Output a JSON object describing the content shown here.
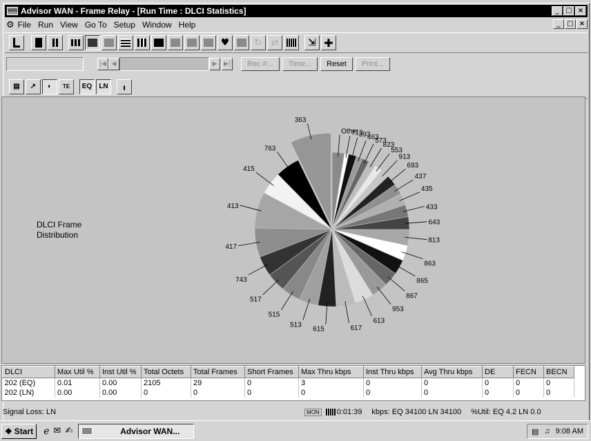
{
  "window": {
    "title": "Advisor WAN - Frame Relay - [Run Time : DLCI Statistics]",
    "min": "_",
    "restore": "&#9633;",
    "close": "x"
  },
  "menu": [
    "File",
    "Run",
    "View",
    "Go To",
    "Setup",
    "Window",
    "Help"
  ],
  "controls": {
    "rec": "Rec #...",
    "time": "Time...",
    "reset": "Reset",
    "print": "Print...",
    "eq": "EQ",
    "ln": "LN"
  },
  "chart_label": "DLCI Frame\nDistribution",
  "chart_data": {
    "type": "pie",
    "title": "DLCI Frame Distribution",
    "slices": [
      {
        "label": "Other",
        "value": 2.3,
        "color": "#8a8a8a"
      },
      {
        "label": "713",
        "value": 0.8,
        "color": "#ffffff"
      },
      {
        "label": "393",
        "value": 1.5,
        "color": "#111111"
      },
      {
        "label": "463",
        "value": 1.2,
        "color": "#9a9a9a"
      },
      {
        "label": "573",
        "value": 1.3,
        "color": "#666666"
      },
      {
        "label": "823",
        "value": 1.4,
        "color": "#bdbdbd"
      },
      {
        "label": "553",
        "value": 1.5,
        "color": "#e8e8e8"
      },
      {
        "label": "913",
        "value": 1.6,
        "color": "#c6c6c6"
      },
      {
        "label": "693",
        "value": 2.0,
        "color": "#222222"
      },
      {
        "label": "437",
        "value": 2.0,
        "color": "#8f8f8f"
      },
      {
        "label": "435",
        "value": 2.2,
        "color": "#b0b0b0"
      },
      {
        "label": "433",
        "value": 2.3,
        "color": "#777777"
      },
      {
        "label": "643",
        "value": 2.4,
        "color": "#444444"
      },
      {
        "label": "813",
        "value": 3.0,
        "color": "#a8a8a8"
      },
      {
        "label": "863",
        "value": 2.9,
        "color": "#ffffff"
      },
      {
        "label": "865",
        "value": 2.8,
        "color": "#111111"
      },
      {
        "label": "867",
        "value": 2.7,
        "color": "#666666"
      },
      {
        "label": "953",
        "value": 3.1,
        "color": "#999999"
      },
      {
        "label": "613",
        "value": 3.6,
        "color": "#dcdcdc"
      },
      {
        "label": "617",
        "value": 3.6,
        "color": "#bbbbbb"
      },
      {
        "label": "615",
        "value": 3.4,
        "color": "#222222"
      },
      {
        "label": "513",
        "value": 3.6,
        "color": "#a0a0a0"
      },
      {
        "label": "515",
        "value": 3.6,
        "color": "#888888"
      },
      {
        "label": "517",
        "value": 3.6,
        "color": "#555555"
      },
      {
        "label": "743",
        "value": 3.8,
        "color": "#333333"
      },
      {
        "label": "417",
        "value": 5.5,
        "color": "#8e8e8e"
      },
      {
        "label": "413",
        "value": 6.8,
        "color": "#a6a6a6"
      },
      {
        "label": "415",
        "value": 4.3,
        "color": "#f2f2f2"
      },
      {
        "label": "763",
        "value": 4.6,
        "color": "#000000"
      },
      {
        "label": "363",
        "value": 6.5,
        "color": "#969696",
        "exploded": true
      }
    ]
  },
  "table": {
    "headers": [
      "DLCI",
      "Max Util %",
      "Inst Util %",
      "Total Octets",
      "Total Frames",
      "Short Frames",
      "Max Thru kbps",
      "Inst Thru kbps",
      "Avg Thru kbps",
      "DE",
      "FECN",
      "BECN"
    ],
    "rows": [
      [
        "202 (EQ)",
        "0.01",
        "0.00",
        "2105",
        "29",
        "0",
        "3",
        "0",
        "0",
        "0",
        "0",
        "0"
      ],
      [
        "202 (LN)",
        "0.00",
        "0.00",
        "0",
        "0",
        "0",
        "0",
        "0",
        "0",
        "0",
        "0",
        "0"
      ]
    ]
  },
  "status": {
    "signal": "Signal Loss: LN",
    "mon": "MON",
    "elapsed": "0:01:39",
    "kbps": "kbps: EQ 34100  LN 34100",
    "util": "%Util: EQ 4.2  LN 0.0"
  },
  "taskbar": {
    "start": "Start",
    "task": "Advisor WAN...",
    "clock": "9:08 AM"
  }
}
